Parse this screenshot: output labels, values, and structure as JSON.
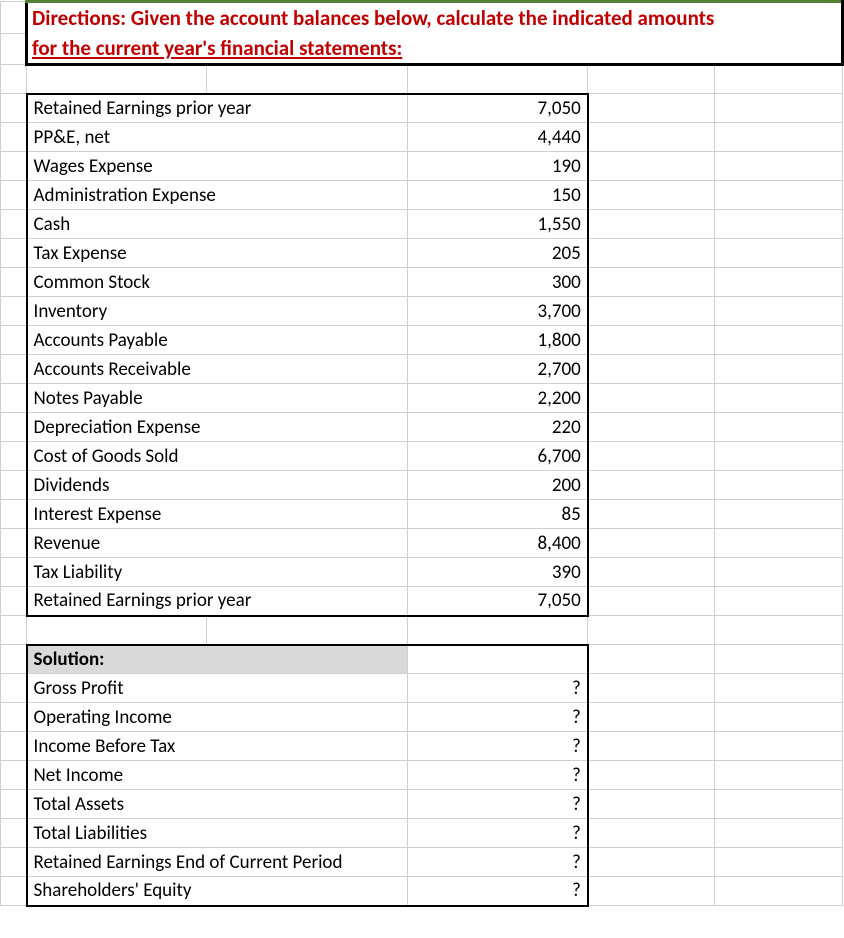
{
  "title_line1": "Directions: Given the account balances below, calculate the indicated amounts",
  "title_line2": "for the current year's financial statements:",
  "accounts": [
    {
      "label": "Retained Earnings prior year",
      "value": "7,050"
    },
    {
      "label": "PP&E, net",
      "value": "4,440"
    },
    {
      "label": "Wages Expense",
      "value": "190"
    },
    {
      "label": "Administration Expense",
      "value": "150"
    },
    {
      "label": "Cash",
      "value": "1,550"
    },
    {
      "label": "Tax Expense",
      "value": "205"
    },
    {
      "label": "Common Stock",
      "value": "300"
    },
    {
      "label": "Inventory",
      "value": "3,700"
    },
    {
      "label": "Accounts Payable",
      "value": "1,800"
    },
    {
      "label": "Accounts Receivable",
      "value": "2,700"
    },
    {
      "label": "Notes Payable",
      "value": "2,200"
    },
    {
      "label": "Depreciation Expense",
      "value": "220"
    },
    {
      "label": "Cost of Goods Sold",
      "value": "6,700"
    },
    {
      "label": "Dividends",
      "value": "200"
    },
    {
      "label": "Interest Expense",
      "value": "85"
    },
    {
      "label": "Revenue",
      "value": "8,400"
    },
    {
      "label": "Tax Liability",
      "value": "390"
    },
    {
      "label": "Retained Earnings prior year",
      "value": "7,050"
    }
  ],
  "solution_header": "Solution:",
  "solution_items": [
    {
      "label": "Gross Profit",
      "value": "?"
    },
    {
      "label": "Operating Income",
      "value": "?"
    },
    {
      "label": "Income Before Tax",
      "value": "?"
    },
    {
      "label": "Net Income",
      "value": "?"
    },
    {
      "label": "Total Assets",
      "value": "?"
    },
    {
      "label": "Total Liabilities",
      "value": "?"
    },
    {
      "label": "Retained Earnings End of Current Period",
      "value": "?"
    },
    {
      "label": "Shareholders' Equity",
      "value": "?"
    }
  ]
}
